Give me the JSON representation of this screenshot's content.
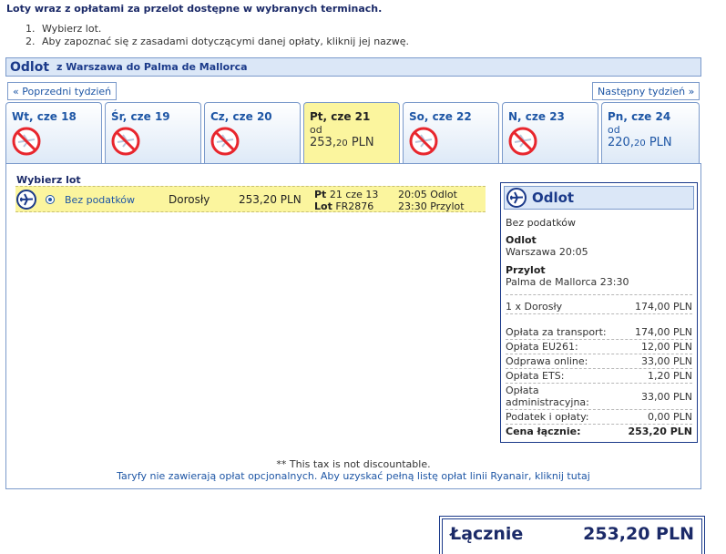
{
  "header": {
    "title": "Loty wraz z opłatami za przelot dostępne w wybranych terminach.",
    "steps": [
      "Wybierz lot.",
      "Aby zapoznać się z zasadami dotyczącymi danej opłaty, kliknij jej nazwę."
    ],
    "step_numbers": [
      "1.",
      "2."
    ]
  },
  "route": {
    "title": "Odlot",
    "subtitle": "z Warszawa do Palma de Mallorca"
  },
  "nav": {
    "prev_week": "« Poprzedni tydzień",
    "next_week": "Następny tydzień »"
  },
  "days": [
    {
      "label": "Wt, cze 18"
    },
    {
      "label": "Śr, cze 19"
    },
    {
      "label": "Cz, cze 20"
    },
    {
      "label": "Pt, cze 21",
      "od": "od",
      "price_main": "253,",
      "price_dec": "20",
      "currency": " PLN"
    },
    {
      "label": "So, cze 22"
    },
    {
      "label": "N, cze 23"
    },
    {
      "label": "Pn, cze 24",
      "od": "od",
      "price_main": "220,",
      "price_dec": "20",
      "currency": " PLN"
    }
  ],
  "flight_list": {
    "title": "Wybierz lot",
    "row": {
      "fare": "Bez podatków",
      "pax": "Dorosły",
      "price": "253,20 PLN",
      "day_name": "Pt",
      "day_date": "21 cze 13",
      "flight_label": "Lot",
      "flight_no": "FR2876",
      "dep": "20:05 Odlot",
      "arr": "23:30 Przylot"
    }
  },
  "summary": {
    "title": "Odlot",
    "fare": "Bez podatków",
    "dep_label": "Odlot",
    "dep_value": "Warszawa 20:05",
    "arr_label": "Przylot",
    "arr_value": "Palma de Mallorca 23:30",
    "pax_line": {
      "label": "1 x Dorosły",
      "value": "174,00 PLN"
    },
    "fees": [
      {
        "label": "Opłata za transport:",
        "value": "174,00 PLN"
      },
      {
        "label": "Opłata EU261:",
        "value": "12,00 PLN"
      },
      {
        "label": "Odprawa online:",
        "value": "33,00 PLN"
      },
      {
        "label": "Opłata ETS:",
        "value": "1,20 PLN"
      },
      {
        "label": "Opłata administracyjna:",
        "value": "33,00 PLN"
      },
      {
        "label": "Podatek i opłaty:",
        "value": "0,00 PLN"
      }
    ],
    "total": {
      "label": "Cena łącznie:",
      "value": "253,20 PLN"
    }
  },
  "notes": {
    "tax": "** This tax is not discountable.",
    "tariff": "Taryfy nie zawierają opłat opcjonalnych. Aby uzyskać pełną listę opłat linii Ryanair, kliknij tutaj"
  },
  "grand_total": {
    "label": "Łącznie",
    "value": "253,20 PLN"
  },
  "colors": {
    "navy": "#1b2a68",
    "link": "#1e56a5",
    "highlight": "#fbf59e",
    "bar": "#dbe7f7",
    "border": "#7b9acb",
    "no_flight": "#e8262d"
  }
}
